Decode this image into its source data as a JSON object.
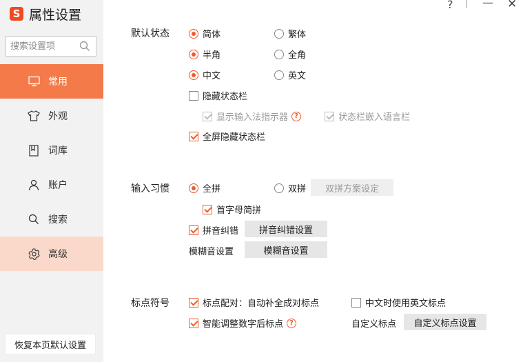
{
  "app": {
    "title": "属性设置",
    "logo_letter": "S"
  },
  "search": {
    "placeholder": "搜索设置项"
  },
  "sidebar": {
    "items": [
      {
        "label": "常用",
        "icon": "monitor-icon",
        "state": "active"
      },
      {
        "label": "外观",
        "icon": "tshirt-icon",
        "state": "normal"
      },
      {
        "label": "词库",
        "icon": "book-icon",
        "state": "normal"
      },
      {
        "label": "账户",
        "icon": "user-icon",
        "state": "normal"
      },
      {
        "label": "搜索",
        "icon": "search-icon",
        "state": "normal"
      },
      {
        "label": "高级",
        "icon": "gear-icon",
        "state": "highlight"
      }
    ],
    "reset_label": "恢复本页默认设置"
  },
  "window": {
    "help": "?",
    "minimize": "—",
    "close": "✕"
  },
  "default_status": {
    "title": "默认状态",
    "simplified": "简体",
    "traditional": "繁体",
    "half_width": "半角",
    "full_width": "全角",
    "chinese": "中文",
    "english": "英文",
    "hide_status_bar": "隐藏状态栏",
    "show_ime_indicator": "显示输入法指示器",
    "embed_lang_bar": "状态栏嵌入语言栏",
    "fullscreen_hide": "全屏隐藏状态栏"
  },
  "input_habit": {
    "title": "输入习惯",
    "full_pinyin": "全拼",
    "double_pinyin": "双拼",
    "double_scheme_btn": "双拼方案设定",
    "initials_abbrev": "首字母简拼",
    "pinyin_correction": "拼音纠错",
    "pinyin_correction_btn": "拼音纠错设置",
    "fuzzy_label": "模糊音设置",
    "fuzzy_btn": "模糊音设置"
  },
  "punctuation": {
    "title": "标点符号",
    "auto_pair": "标点配对：自动补全成对标点",
    "english_punct_in_chinese": "中文时使用英文标点",
    "smart_digit_punct": "智能调整数字后标点",
    "custom_label": "自定义标点",
    "custom_btn": "自定义标点设置"
  },
  "colors": {
    "accent": "#f05a2a",
    "nav_active": "#f47a4a",
    "nav_highlight": "#fbd9ca"
  }
}
